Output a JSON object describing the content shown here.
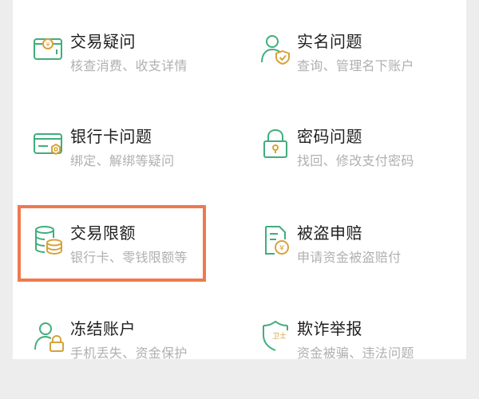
{
  "items": [
    {
      "title": "交易疑问",
      "subtitle": "核查消费、收支详情",
      "icon": "wallet-yuan-icon"
    },
    {
      "title": "实名问题",
      "subtitle": "查询、管理名下账户",
      "icon": "user-shield-icon"
    },
    {
      "title": "银行卡问题",
      "subtitle": "绑定、解绑等疑问",
      "icon": "bank-card-icon"
    },
    {
      "title": "密码问题",
      "subtitle": "找回、修改支付密码",
      "icon": "lock-icon"
    },
    {
      "title": "交易限额",
      "subtitle": "银行卡、零钱限额等",
      "icon": "coin-stack-icon"
    },
    {
      "title": "被盗申赔",
      "subtitle": "申请资金被盗赔付",
      "icon": "document-yuan-icon"
    },
    {
      "title": "冻结账户",
      "subtitle": "手机丢失、资金保护",
      "icon": "user-lock-icon"
    },
    {
      "title": "欺诈举报",
      "subtitle": "资金被骗、违法问题",
      "icon": "guard-shield-icon"
    }
  ],
  "icon_text": {
    "guard": "卫士"
  },
  "colors": {
    "green": "#3fae7c",
    "gold": "#d6a33a",
    "highlight": "#ee7a4d"
  }
}
